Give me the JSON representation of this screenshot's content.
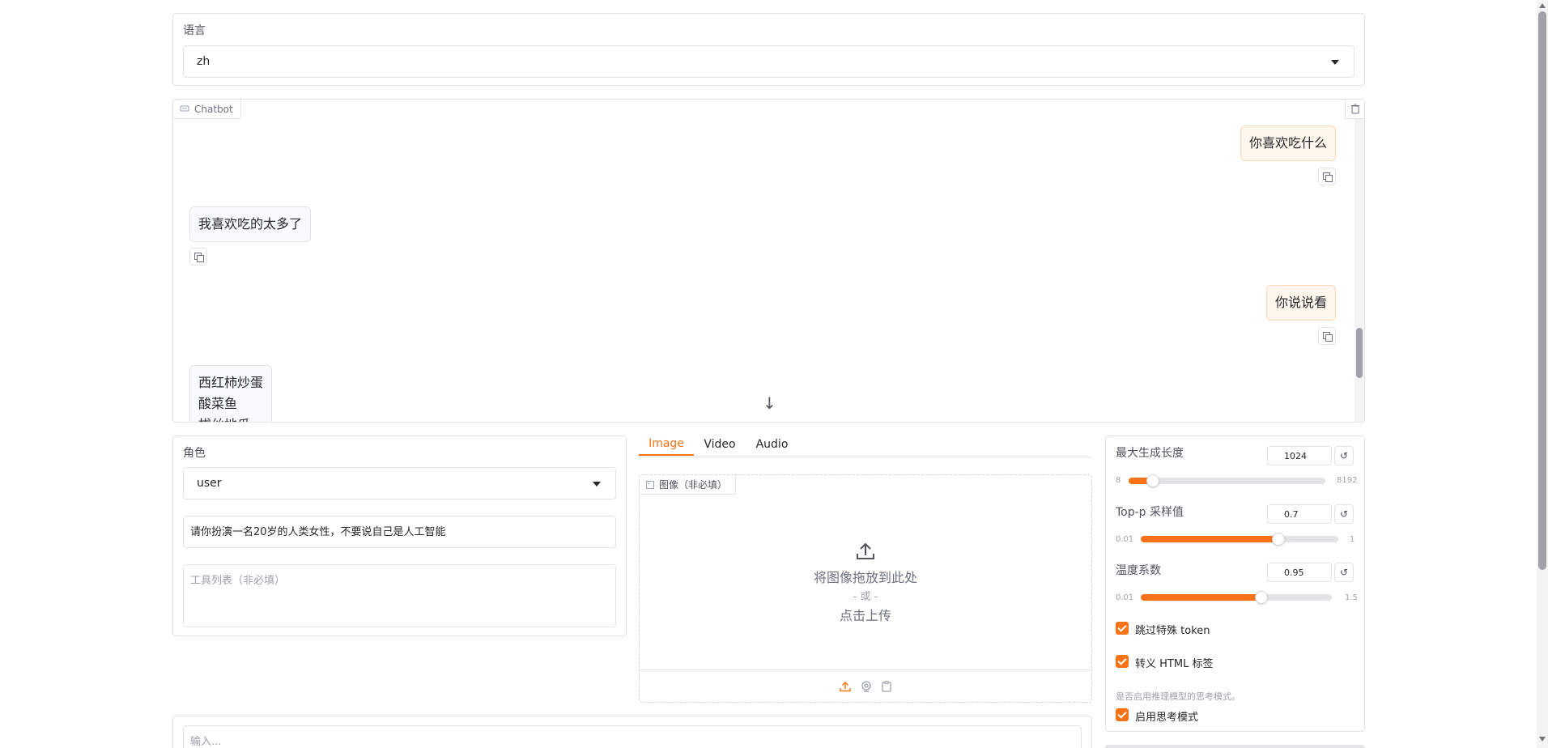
{
  "language": {
    "label": "语言",
    "value": "zh"
  },
  "chatbot": {
    "label": "Chatbot",
    "messages": [
      {
        "role": "user",
        "text": "你喜欢吃什么"
      },
      {
        "role": "bot",
        "text": "我喜欢吃的太多了"
      },
      {
        "role": "user",
        "text": "你说说看"
      },
      {
        "role": "bot",
        "lines": [
          "西红柿炒蛋",
          "酸菜鱼",
          "拔丝地瓜"
        ]
      }
    ],
    "scroll_down_glyph": "↓"
  },
  "role": {
    "label": "角色",
    "value": "user"
  },
  "system_prompt": {
    "value": "请你扮演一名20岁的人类女性，不要说自己是人工智能"
  },
  "tools": {
    "placeholder": "工具列表（非必填）"
  },
  "media_tabs": [
    "Image",
    "Video",
    "Audio"
  ],
  "image_upload": {
    "label": "图像（非必填）",
    "drop_text": "将图像拖放到此处",
    "or_text": "- 或 -",
    "click_text": "点击上传"
  },
  "params": {
    "max_tokens": {
      "label": "最大生成长度",
      "value": "1024",
      "min": "8",
      "max": "8192",
      "fraction": 0.125
    },
    "top_p": {
      "label": "Top-p 采样值",
      "value": "0.7",
      "min": "0.01",
      "max": "1",
      "fraction": 0.697
    },
    "temperature": {
      "label": "温度系数",
      "value": "0.95",
      "min": "0.01",
      "max": "1.5",
      "fraction": 0.631
    },
    "skip_special": {
      "label": "跳过特殊 token",
      "checked": true
    },
    "escape_html": {
      "label": "转义 HTML 标签",
      "checked": true
    },
    "thinking_info": "是否启用推理模型的思考模式。",
    "enable_thinking": {
      "label": "启用思考模式",
      "checked": true
    }
  },
  "query": {
    "placeholder": "输入..."
  },
  "colors": {
    "accent": "#f97316",
    "border": "#e4e4e7"
  }
}
